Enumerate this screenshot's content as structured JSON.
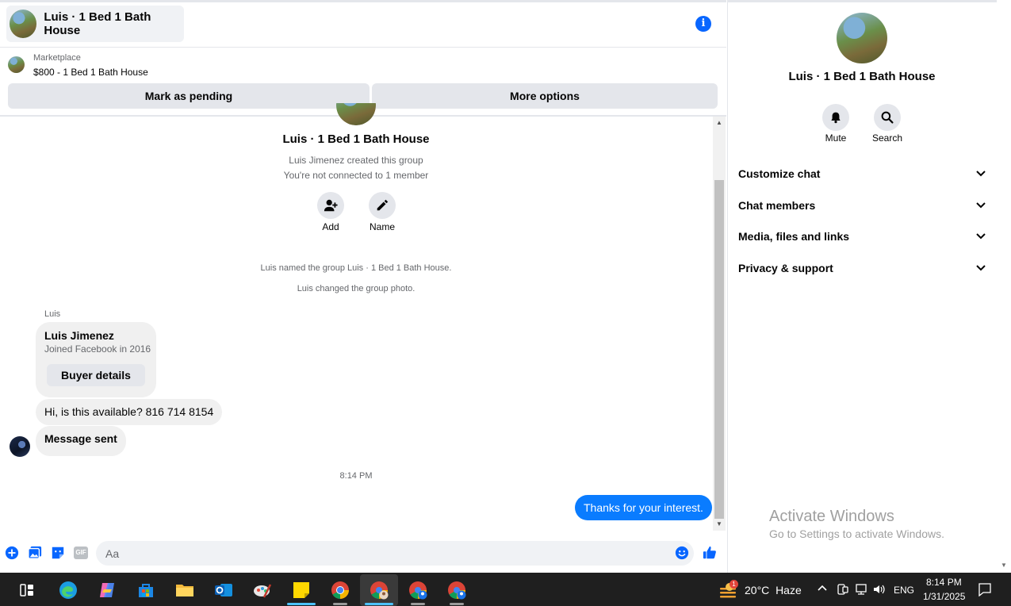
{
  "header": {
    "title": "Luis · 1 Bed 1 Bath House",
    "info_icon": "info-icon"
  },
  "marketplace": {
    "label": "Marketplace",
    "listing": "$800 - 1 Bed 1 Bath House",
    "mark_pending_label": "Mark as pending",
    "more_options_label": "More options"
  },
  "conversation": {
    "group_name": "Luis · 1 Bed 1 Bath House",
    "created_by": "Luis Jimenez created this group",
    "not_connected": "You're not connected to 1 member",
    "add_label": "Add",
    "name_label": "Name",
    "system_messages": [
      "Luis named the group Luis · 1 Bed 1 Bath House.",
      "Luis changed the group photo."
    ],
    "sender_name": "Luis",
    "buyer_card": {
      "name": "Luis Jimenez",
      "joined": "Joined Facebook in 2016",
      "button_label": "Buyer details"
    },
    "incoming_messages": [
      "Hi, is this available? 816 714 8154",
      "Message sent"
    ],
    "timestamp": "8:14 PM",
    "outgoing_message": "Thanks for your interest."
  },
  "composer": {
    "placeholder": "Aa",
    "icons": [
      "plus-circle-icon",
      "photo-icon",
      "sticker-icon",
      "gif-icon",
      "emoji-icon",
      "thumbs-up-icon"
    ],
    "gif_text": "GIF"
  },
  "right_panel": {
    "title": "Luis · 1 Bed 1 Bath House",
    "mute_label": "Mute",
    "search_label": "Search",
    "sections": [
      "Customize chat",
      "Chat members",
      "Media, files and links",
      "Privacy & support"
    ]
  },
  "watermark": {
    "title": "Activate Windows",
    "subtitle": "Go to Settings to activate Windows."
  },
  "taskbar": {
    "apps": [
      "task-view-icon",
      "edge-icon",
      "copilot-icon",
      "store-icon",
      "file-explorer-icon",
      "outlook-icon",
      "paint-app-icon",
      "sticky-notes-icon",
      "chrome-icon",
      "chrome-profile-icon",
      "chrome-profile-icon",
      "chrome-profile-icon"
    ],
    "weather_badge": "1",
    "temperature": "20°C",
    "weather_condition": "Haze",
    "language": "ENG",
    "time": "8:14 PM",
    "date": "1/31/2025"
  },
  "colors": {
    "accent_blue": "#0866ff",
    "outgoing_bubble": "#0a7cff",
    "incoming_bubble": "#f0f0f0",
    "taskbar": "#1f1f1f"
  }
}
